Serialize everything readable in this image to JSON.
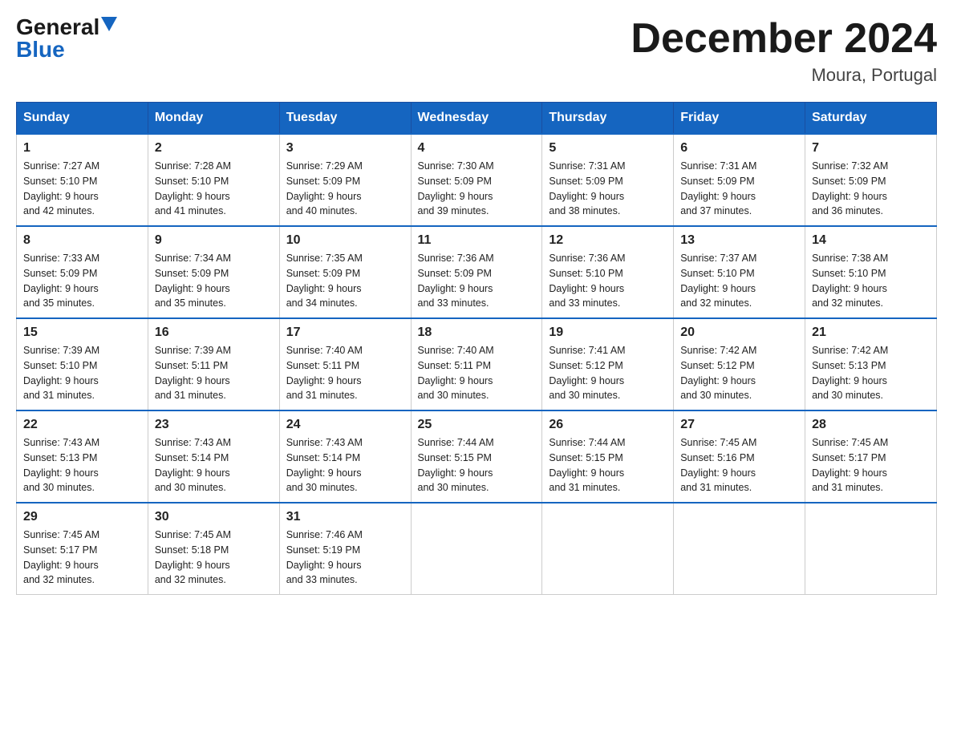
{
  "header": {
    "logo_general": "General",
    "logo_blue": "Blue",
    "month_title": "December 2024",
    "location": "Moura, Portugal"
  },
  "days_of_week": [
    "Sunday",
    "Monday",
    "Tuesday",
    "Wednesday",
    "Thursday",
    "Friday",
    "Saturday"
  ],
  "weeks": [
    [
      {
        "day": "1",
        "sunrise": "7:27 AM",
        "sunset": "5:10 PM",
        "daylight": "9 hours and 42 minutes."
      },
      {
        "day": "2",
        "sunrise": "7:28 AM",
        "sunset": "5:10 PM",
        "daylight": "9 hours and 41 minutes."
      },
      {
        "day": "3",
        "sunrise": "7:29 AM",
        "sunset": "5:09 PM",
        "daylight": "9 hours and 40 minutes."
      },
      {
        "day": "4",
        "sunrise": "7:30 AM",
        "sunset": "5:09 PM",
        "daylight": "9 hours and 39 minutes."
      },
      {
        "day": "5",
        "sunrise": "7:31 AM",
        "sunset": "5:09 PM",
        "daylight": "9 hours and 38 minutes."
      },
      {
        "day": "6",
        "sunrise": "7:31 AM",
        "sunset": "5:09 PM",
        "daylight": "9 hours and 37 minutes."
      },
      {
        "day": "7",
        "sunrise": "7:32 AM",
        "sunset": "5:09 PM",
        "daylight": "9 hours and 36 minutes."
      }
    ],
    [
      {
        "day": "8",
        "sunrise": "7:33 AM",
        "sunset": "5:09 PM",
        "daylight": "9 hours and 35 minutes."
      },
      {
        "day": "9",
        "sunrise": "7:34 AM",
        "sunset": "5:09 PM",
        "daylight": "9 hours and 35 minutes."
      },
      {
        "day": "10",
        "sunrise": "7:35 AM",
        "sunset": "5:09 PM",
        "daylight": "9 hours and 34 minutes."
      },
      {
        "day": "11",
        "sunrise": "7:36 AM",
        "sunset": "5:09 PM",
        "daylight": "9 hours and 33 minutes."
      },
      {
        "day": "12",
        "sunrise": "7:36 AM",
        "sunset": "5:10 PM",
        "daylight": "9 hours and 33 minutes."
      },
      {
        "day": "13",
        "sunrise": "7:37 AM",
        "sunset": "5:10 PM",
        "daylight": "9 hours and 32 minutes."
      },
      {
        "day": "14",
        "sunrise": "7:38 AM",
        "sunset": "5:10 PM",
        "daylight": "9 hours and 32 minutes."
      }
    ],
    [
      {
        "day": "15",
        "sunrise": "7:39 AM",
        "sunset": "5:10 PM",
        "daylight": "9 hours and 31 minutes."
      },
      {
        "day": "16",
        "sunrise": "7:39 AM",
        "sunset": "5:11 PM",
        "daylight": "9 hours and 31 minutes."
      },
      {
        "day": "17",
        "sunrise": "7:40 AM",
        "sunset": "5:11 PM",
        "daylight": "9 hours and 31 minutes."
      },
      {
        "day": "18",
        "sunrise": "7:40 AM",
        "sunset": "5:11 PM",
        "daylight": "9 hours and 30 minutes."
      },
      {
        "day": "19",
        "sunrise": "7:41 AM",
        "sunset": "5:12 PM",
        "daylight": "9 hours and 30 minutes."
      },
      {
        "day": "20",
        "sunrise": "7:42 AM",
        "sunset": "5:12 PM",
        "daylight": "9 hours and 30 minutes."
      },
      {
        "day": "21",
        "sunrise": "7:42 AM",
        "sunset": "5:13 PM",
        "daylight": "9 hours and 30 minutes."
      }
    ],
    [
      {
        "day": "22",
        "sunrise": "7:43 AM",
        "sunset": "5:13 PM",
        "daylight": "9 hours and 30 minutes."
      },
      {
        "day": "23",
        "sunrise": "7:43 AM",
        "sunset": "5:14 PM",
        "daylight": "9 hours and 30 minutes."
      },
      {
        "day": "24",
        "sunrise": "7:43 AM",
        "sunset": "5:14 PM",
        "daylight": "9 hours and 30 minutes."
      },
      {
        "day": "25",
        "sunrise": "7:44 AM",
        "sunset": "5:15 PM",
        "daylight": "9 hours and 30 minutes."
      },
      {
        "day": "26",
        "sunrise": "7:44 AM",
        "sunset": "5:15 PM",
        "daylight": "9 hours and 31 minutes."
      },
      {
        "day": "27",
        "sunrise": "7:45 AM",
        "sunset": "5:16 PM",
        "daylight": "9 hours and 31 minutes."
      },
      {
        "day": "28",
        "sunrise": "7:45 AM",
        "sunset": "5:17 PM",
        "daylight": "9 hours and 31 minutes."
      }
    ],
    [
      {
        "day": "29",
        "sunrise": "7:45 AM",
        "sunset": "5:17 PM",
        "daylight": "9 hours and 32 minutes."
      },
      {
        "day": "30",
        "sunrise": "7:45 AM",
        "sunset": "5:18 PM",
        "daylight": "9 hours and 32 minutes."
      },
      {
        "day": "31",
        "sunrise": "7:46 AM",
        "sunset": "5:19 PM",
        "daylight": "9 hours and 33 minutes."
      },
      null,
      null,
      null,
      null
    ]
  ],
  "labels": {
    "sunrise_label": "Sunrise:",
    "sunset_label": "Sunset:",
    "daylight_label": "Daylight:"
  }
}
